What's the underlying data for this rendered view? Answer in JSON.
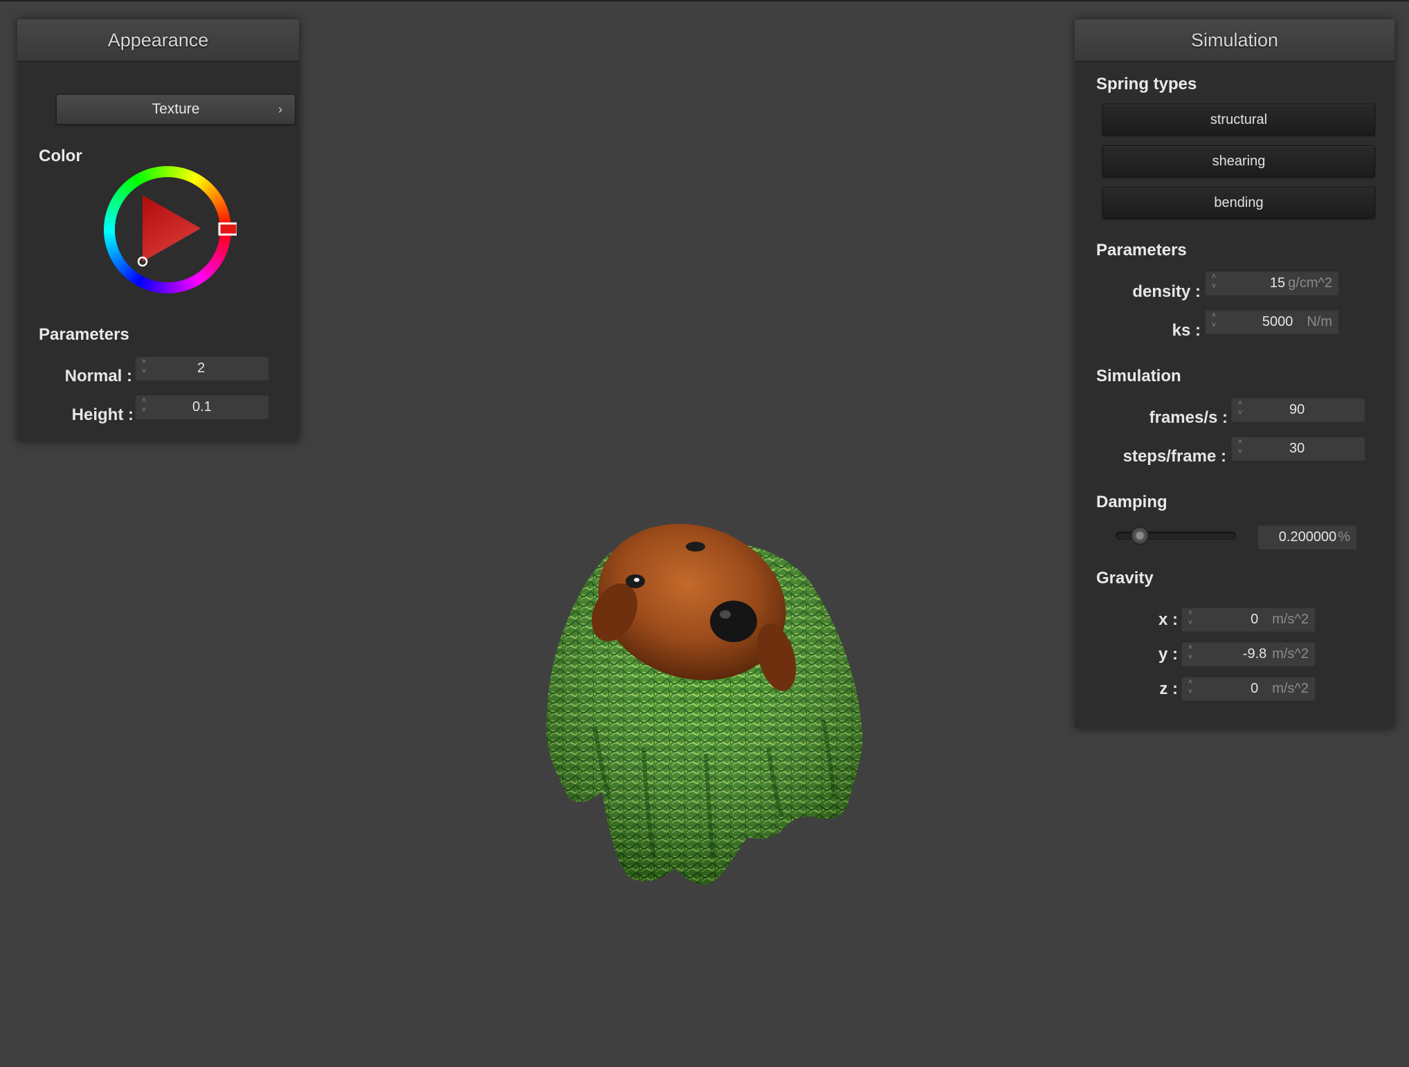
{
  "appearance": {
    "title": "Appearance",
    "texture_button": "Texture",
    "texture_chevron": "›",
    "color_title": "Color",
    "color_value": "#ff0000",
    "parameters_title": "Parameters",
    "normal_label": "Normal :",
    "normal_value": "2",
    "height_label": "Height :",
    "height_value": "0.1"
  },
  "simulation": {
    "title": "Simulation",
    "spring_types_title": "Spring types",
    "spring_buttons": [
      "structural",
      "shearing",
      "bending"
    ],
    "parameters_title": "Parameters",
    "density_label": "density :",
    "density_value": "15",
    "density_unit": "g/cm^2",
    "ks_label": "ks :",
    "ks_value": "5000",
    "ks_unit": "N/m",
    "simulation_title": "Simulation",
    "fps_label": "frames/s :",
    "fps_value": "90",
    "steps_label": "steps/frame :",
    "steps_value": "30",
    "damping_title": "Damping",
    "damping_value": "0.200000",
    "damping_unit": "%",
    "damping_level": 0.2,
    "gravity_title": "Gravity",
    "gx_label": "x :",
    "gx_value": "0",
    "gy_label": "y :",
    "gy_value": "-9.8",
    "gz_label": "z :",
    "gz_value": "0",
    "gravity_unit": "m/s^2"
  },
  "viewport": {
    "background": "#404040",
    "cloth_texture": "grass-and-dog-photo"
  }
}
